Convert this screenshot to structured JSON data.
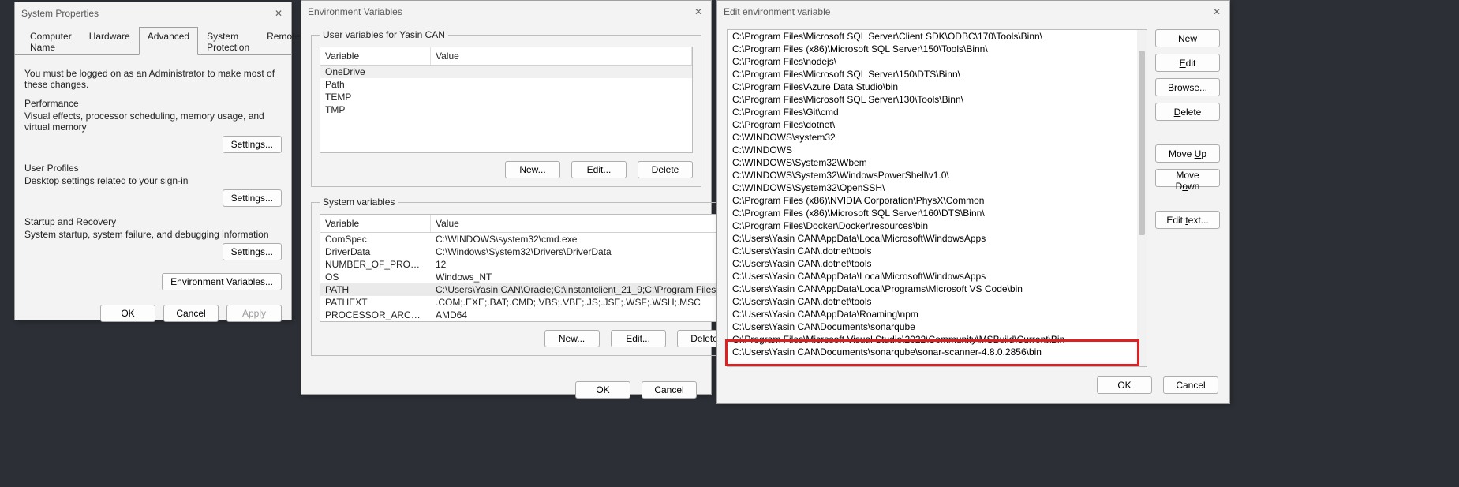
{
  "sysprops": {
    "title": "System Properties",
    "close": "✕",
    "tabs": [
      "Computer Name",
      "Hardware",
      "Advanced",
      "System Protection",
      "Remote"
    ],
    "active_tab": 2,
    "note": "You must be logged on as an Administrator to make most of these changes.",
    "groups": {
      "perf": {
        "head": "Performance",
        "desc": "Visual effects, processor scheduling, memory usage, and virtual memory",
        "btn": "Settings..."
      },
      "profiles": {
        "head": "User Profiles",
        "desc": "Desktop settings related to your sign-in",
        "btn": "Settings..."
      },
      "startup": {
        "head": "Startup and Recovery",
        "desc": "System startup, system failure, and debugging information",
        "btn": "Settings..."
      }
    },
    "envvars_btn": "Environment Variables...",
    "footer": {
      "ok": "OK",
      "cancel": "Cancel",
      "apply": "Apply"
    }
  },
  "envvars": {
    "title": "Environment Variables",
    "close": "✕",
    "user_legend": "User variables for Yasin CAN",
    "sys_legend": "System variables",
    "headers": {
      "variable": "Variable",
      "value": "Value"
    },
    "user_rows": [
      {
        "var": "OneDrive",
        "val": ""
      },
      {
        "var": "Path",
        "val": ""
      },
      {
        "var": "TEMP",
        "val": ""
      },
      {
        "var": "TMP",
        "val": ""
      }
    ],
    "sys_rows": [
      {
        "var": "ComSpec",
        "val": "C:\\WINDOWS\\system32\\cmd.exe"
      },
      {
        "var": "DriverData",
        "val": "C:\\Windows\\System32\\Drivers\\DriverData"
      },
      {
        "var": "NUMBER_OF_PROCESSORS",
        "val": "12"
      },
      {
        "var": "OS",
        "val": "Windows_NT"
      },
      {
        "var": "PATH",
        "val": "C:\\Users\\Yasin CAN\\Oracle;C:\\instantclient_21_9;C:\\Program Files\\..."
      },
      {
        "var": "PATHEXT",
        "val": ".COM;.EXE;.BAT;.CMD;.VBS;.VBE;.JS;.JSE;.WSF;.WSH;.MSC"
      },
      {
        "var": "PROCESSOR_ARCHITECTURE",
        "val": "AMD64"
      }
    ],
    "buttons": {
      "new": "New...",
      "edit": "Edit...",
      "delete": "Delete",
      "ok": "OK",
      "cancel": "Cancel"
    }
  },
  "editvar": {
    "title": "Edit environment variable",
    "close": "✕",
    "items": [
      "C:\\Program Files\\Microsoft SQL Server\\Client SDK\\ODBC\\170\\Tools\\Binn\\",
      "C:\\Program Files (x86)\\Microsoft SQL Server\\150\\Tools\\Binn\\",
      "C:\\Program Files\\nodejs\\",
      "C:\\Program Files\\Microsoft SQL Server\\150\\DTS\\Binn\\",
      "C:\\Program Files\\Azure Data Studio\\bin",
      "C:\\Program Files\\Microsoft SQL Server\\130\\Tools\\Binn\\",
      "C:\\Program Files\\Git\\cmd",
      "C:\\Program Files\\dotnet\\",
      "C:\\WINDOWS\\system32",
      "C:\\WINDOWS",
      "C:\\WINDOWS\\System32\\Wbem",
      "C:\\WINDOWS\\System32\\WindowsPowerShell\\v1.0\\",
      "C:\\WINDOWS\\System32\\OpenSSH\\",
      "C:\\Program Files (x86)\\NVIDIA Corporation\\PhysX\\Common",
      "C:\\Program Files (x86)\\Microsoft SQL Server\\160\\DTS\\Binn\\",
      "C:\\Program Files\\Docker\\Docker\\resources\\bin",
      "C:\\Users\\Yasin CAN\\AppData\\Local\\Microsoft\\WindowsApps",
      "C:\\Users\\Yasin CAN\\.dotnet\\tools",
      "C:\\Users\\Yasin CAN\\.dotnet\\tools",
      "C:\\Users\\Yasin CAN\\AppData\\Local\\Microsoft\\WindowsApps",
      "C:\\Users\\Yasin CAN\\AppData\\Local\\Programs\\Microsoft VS Code\\bin",
      "C:\\Users\\Yasin CAN\\.dotnet\\tools",
      "C:\\Users\\Yasin CAN\\AppData\\Roaming\\npm",
      "C:\\Users\\Yasin CAN\\Documents\\sonarqube",
      "C:\\Program Files\\Microsoft Visual Studio\\2022\\Community\\MSBuild\\Current\\Bin",
      "C:\\Users\\Yasin CAN\\Documents\\sonarqube\\sonar-scanner-4.8.0.2856\\bin"
    ],
    "buttons": {
      "new": "New",
      "edit": "Edit",
      "browse": "Browse...",
      "delete": "Delete",
      "moveup": "Move Up",
      "movedown": "Move Down",
      "edittext": "Edit text...",
      "ok": "OK",
      "cancel": "Cancel"
    }
  }
}
